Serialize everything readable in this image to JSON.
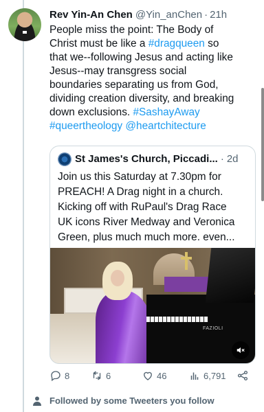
{
  "tweet": {
    "author_name": "Rev Yin-An Chen",
    "author_handle": "@Yin_anChen",
    "separator": "·",
    "time": "21h",
    "lines": [
      [
        {
          "t": "People miss the point: The Body of",
          "link": false
        }
      ],
      [
        {
          "t": "Christ must be like a ",
          "link": false
        },
        {
          "t": "#dragqueen",
          "link": true
        },
        {
          "t": " so",
          "link": false
        }
      ],
      [
        {
          "t": "that we--following Jesus and acting like",
          "link": false
        }
      ],
      [
        {
          "t": "Jesus--may transgress social",
          "link": false
        }
      ],
      [
        {
          "t": "boundaries separating us from God,",
          "link": false
        }
      ],
      [
        {
          "t": "dividing creation diversity, and breaking",
          "link": false
        }
      ],
      [
        {
          "t": "down exclusions. ",
          "link": false
        },
        {
          "t": "#SashayAway",
          "link": true
        }
      ],
      [
        {
          "t": "#queertheology",
          "link": true
        },
        {
          "t": " ",
          "link": false
        },
        {
          "t": "@heartchitecture",
          "link": true
        }
      ]
    ]
  },
  "quoted": {
    "author_name": "St James's Church, Piccadi...",
    "separator": "·",
    "time": "2d",
    "lines": [
      "Join us this Saturday at 7.30pm for",
      "PREACH! A Drag night in a church.",
      "Kicking off with RuPaul's Drag Race",
      "UK icons River Medway and Veronica",
      "Green, plus much much more. even..."
    ],
    "media_brand": "FAZIOLI",
    "mute_icon": "mute-icon"
  },
  "actions": {
    "replies": "8",
    "retweets": "6",
    "likes": "46",
    "views": "6,791",
    "share_icon": "share-icon"
  },
  "followed_text": "Followed by some Tweeters you follow",
  "colors": {
    "link": "#1d9bf0",
    "secondary_text": "#536471",
    "border": "#cfd9de"
  }
}
